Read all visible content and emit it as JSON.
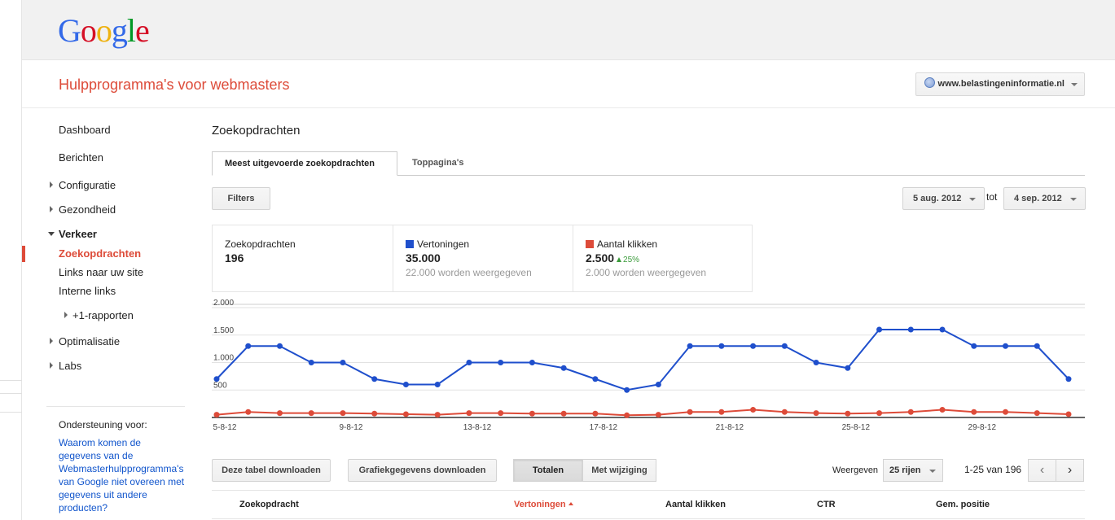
{
  "brand": {
    "logo_letters": [
      "G",
      "o",
      "o",
      "g",
      "l",
      "e"
    ],
    "logo_colors": [
      "#3369e8",
      "#d50f25",
      "#eeb211",
      "#3369e8",
      "#009925",
      "#d50f25"
    ]
  },
  "header": {
    "app_title": "Hulpprogramma's voor webmasters",
    "site": "www.belastingeninformatie.nl"
  },
  "sidebar": {
    "items": [
      {
        "label": "Dashboard"
      },
      {
        "label": "Berichten"
      },
      {
        "label": "Configuratie"
      },
      {
        "label": "Gezondheid"
      },
      {
        "label": "Verkeer"
      },
      {
        "label": "Zoekopdrachten"
      },
      {
        "label": "Links naar uw site"
      },
      {
        "label": "Interne links"
      },
      {
        "label": "+1-rapporten"
      },
      {
        "label": "Optimalisatie"
      },
      {
        "label": "Labs"
      }
    ],
    "support_title": "Ondersteuning voor:",
    "support_link": "Waarom komen de gegevens van de Webmasterhulpprogramma's van Google niet overeen met gegevens uit andere producten?"
  },
  "main": {
    "title": "Zoekopdrachten",
    "tabs": [
      {
        "label": "Meest uitgevoerde zoekopdrachten"
      },
      {
        "label": "Toppagina's"
      }
    ],
    "filters_label": "Filters",
    "date_from": "5 aug. 2012",
    "date_to_word": "tot",
    "date_to": "4 sep. 2012",
    "stats": {
      "queries": {
        "label": "Zoekopdrachten",
        "value": "196"
      },
      "impressions": {
        "label": "Vertoningen",
        "value": "35.000",
        "sub": "22.000 worden weergegeven",
        "color": "#1f4fcc"
      },
      "clicks": {
        "label": "Aantal klikken",
        "value": "2.500",
        "delta": "25%",
        "sub": "2.000 worden weergegeven",
        "color": "#dd4b39"
      }
    }
  },
  "chart_data": {
    "type": "line",
    "x": [
      "5-8-12",
      "6-8-12",
      "7-8-12",
      "8-8-12",
      "9-8-12",
      "10-8-12",
      "11-8-12",
      "12-8-12",
      "13-8-12",
      "14-8-12",
      "15-8-12",
      "16-8-12",
      "17-8-12",
      "18-8-12",
      "19-8-12",
      "20-8-12",
      "21-8-12",
      "22-8-12",
      "23-8-12",
      "24-8-12",
      "25-8-12",
      "26-8-12",
      "27-8-12",
      "28-8-12",
      "29-8-12",
      "30-8-12",
      "31-8-12",
      "1-9-12"
    ],
    "x_tick_labels": [
      "5-8-12",
      "9-8-12",
      "13-8-12",
      "17-8-12",
      "21-8-12",
      "25-8-12",
      "29-8-12"
    ],
    "y_tick_labels": [
      "2.000",
      "1.500",
      "1.000",
      "500"
    ],
    "ylim": [
      0,
      2000
    ],
    "grid": true,
    "series": [
      {
        "name": "Vertoningen",
        "color": "#1f4fcc",
        "values": [
          700,
          1300,
          1300,
          1000,
          1000,
          700,
          600,
          600,
          1000,
          1000,
          1000,
          900,
          700,
          500,
          600,
          1300,
          1300,
          1300,
          1300,
          1000,
          900,
          1600,
          1600,
          1600,
          1300,
          1300,
          1300,
          700
        ]
      },
      {
        "name": "Aantal klikken",
        "color": "#dd4b39",
        "values": [
          50,
          100,
          80,
          80,
          80,
          70,
          60,
          50,
          80,
          80,
          70,
          70,
          70,
          40,
          50,
          100,
          100,
          140,
          100,
          80,
          70,
          80,
          100,
          140,
          100,
          100,
          80,
          60
        ]
      }
    ]
  },
  "toolbar": {
    "download_table": "Deze tabel downloaden",
    "download_chart": "Grafiekgegevens downloaden",
    "totals": "Totalen",
    "with_change": "Met wijziging",
    "show_label": "Weergeven",
    "rows": "25 rijen",
    "pager": "1-25 van 196",
    "prev": "‹",
    "next": "›"
  },
  "table": {
    "headers": [
      "Zoekopdracht",
      "Vertoningen",
      "Aantal klikken",
      "CTR",
      "Gem. positie"
    ]
  }
}
